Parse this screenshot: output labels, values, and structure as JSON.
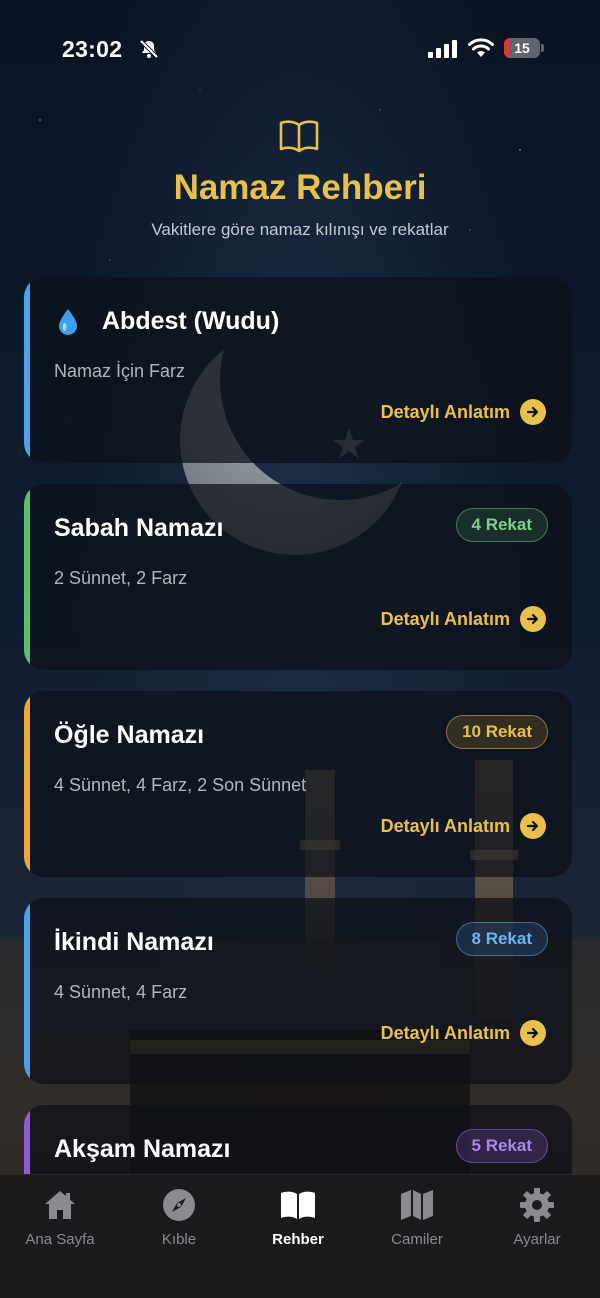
{
  "status_bar": {
    "time": "23:02",
    "battery": "15",
    "battery_level": 0.15
  },
  "header": {
    "title": "Namaz Rehberi",
    "subtitle": "Vakitlere göre namaz kılınışı ve rekatlar",
    "icon": "open-book-icon"
  },
  "cards": [
    {
      "title": "Abdest (Wudu)",
      "subtitle": "Namaz İçin Farz",
      "icon": "water-drop-icon",
      "accent": "#4aa3e8",
      "detail": "Detaylı Anlatım"
    },
    {
      "title": "Sabah Namazı",
      "subtitle": "2 Sünnet, 2 Farz",
      "badge": "4 Rekat",
      "accent": "#5bbf6a",
      "badge_color": "#7fd08c",
      "detail": "Detaylı Anlatım"
    },
    {
      "title": "Öğle Namazı",
      "subtitle": "4 Sünnet, 4 Farz, 2 Son Sünnet",
      "badge": "10 Rekat",
      "accent": "#f0a53a",
      "badge_color": "#e9c04a",
      "detail": "Detaylı Anlatım"
    },
    {
      "title": "İkindi Namazı",
      "subtitle": "4 Sünnet, 4 Farz",
      "badge": "8 Rekat",
      "accent": "#4aa3e8",
      "badge_color": "#6fb4ee",
      "detail": "Detaylı Anlatım"
    },
    {
      "title": "Akşam Namazı",
      "badge": "5 Rekat",
      "accent": "#8e5bd6",
      "badge_color": "#a887e6"
    }
  ],
  "tabs": [
    {
      "label": "Ana Sayfa",
      "icon": "home-icon",
      "active": false
    },
    {
      "label": "Kıble",
      "icon": "compass-icon",
      "active": false
    },
    {
      "label": "Rehber",
      "icon": "book-icon",
      "active": true
    },
    {
      "label": "Camiler",
      "icon": "map-icon",
      "active": false
    },
    {
      "label": "Ayarlar",
      "icon": "gear-icon",
      "active": false
    }
  ],
  "colors": {
    "gold": "#e9c04a",
    "background": "#0b1524",
    "tabbar": "#1b1b1d"
  }
}
